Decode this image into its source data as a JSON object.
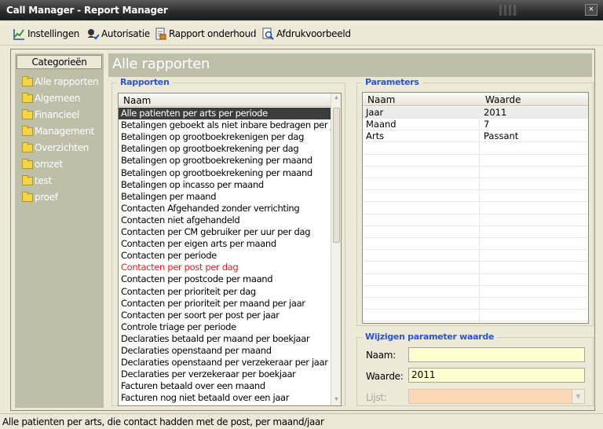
{
  "window": {
    "title": "Call Manager - Report Manager",
    "close_glyph": "×"
  },
  "toolbar": {
    "items": [
      {
        "label": "Instellingen",
        "icon": "settings-chart-icon"
      },
      {
        "label": "Autorisatie",
        "icon": "authorization-icon"
      },
      {
        "label": "Rapport onderhoud",
        "icon": "report-maintenance-icon"
      },
      {
        "label": "Afdrukvoorbeeld",
        "icon": "print-preview-icon"
      }
    ]
  },
  "sidebar": {
    "header": "Categorieën",
    "items": [
      "Alle rapporten",
      "Algemeen",
      "Financieel",
      "Management",
      "Overzichten",
      "omzet",
      "test",
      "proef"
    ]
  },
  "main": {
    "title": "Alle rapporten"
  },
  "reports": {
    "legend": "Rapporten",
    "column": "Naam",
    "items": [
      "Alle patienten per arts per periode",
      "Betalingen geboekt als niet inbare bedragen per j...",
      "Betalingen op grootboekrekenigen per dag",
      "Betalingen op grootboekrekening per dag",
      "Betalingen op grootboekrekening per maand",
      "Betalingen op grootboekrekening per maand",
      "Betalingen op incasso per maand",
      "Betalingen per maand",
      "Contacten Afgehanded zonder verrichting",
      "Contacten niet afgehandeld",
      "Contacten per CM gebruiker per uur per dag",
      "Contacten per eigen arts per maand",
      "Contacten per periode",
      "Contacten per post per dag",
      "Contacten per postcode per maand",
      "Contacten per prioriteit per dag",
      "Contacten per prioriteit per maand per jaar",
      "Contacten per soort per post per jaar",
      "Controle triage per periode",
      "Declaraties betaald per maand per boekjaar",
      "Declaraties openstaand per maand",
      "Declaraties openstaand per verzekeraar per jaar",
      "Declaraties per verzekeraar per boekjaar",
      "Facturen betaald over een maand",
      "Facturen nog niet betaald over een jaar"
    ],
    "selected_index": 0,
    "highlight_index": 13
  },
  "parameters": {
    "legend": "Parameters",
    "columns": [
      "Naam",
      "Waarde"
    ],
    "rows": [
      {
        "naam": "Jaar",
        "waarde": "2011"
      },
      {
        "naam": "Maand",
        "waarde": "7"
      },
      {
        "naam": "Arts",
        "waarde": "Passant"
      }
    ]
  },
  "edit": {
    "legend": "Wijzigen parameter waarde",
    "naam_label": "Naam:",
    "naam_value": "",
    "waarde_label": "Waarde:",
    "waarde_value": "2011",
    "lijst_label": "Lijst:",
    "lijst_value": ""
  },
  "status": {
    "text": "Alle patienten per arts, die contact hadden met de post, per maand/jaar"
  }
}
